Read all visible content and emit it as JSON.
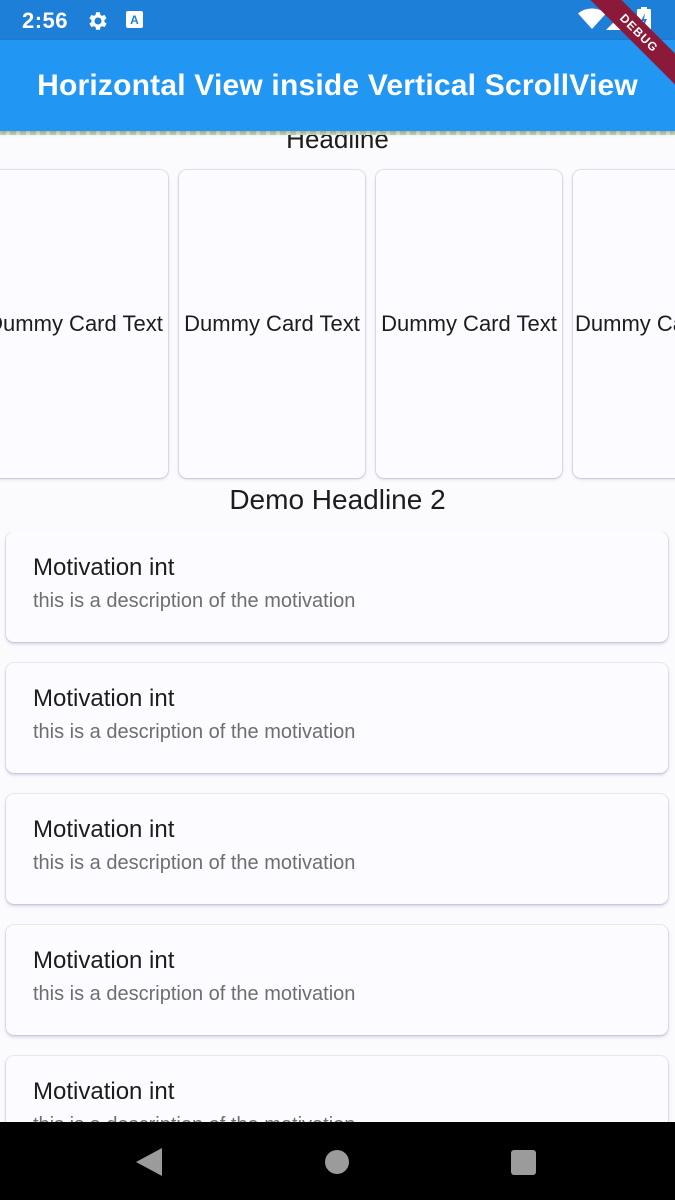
{
  "status_bar": {
    "time": "2:56",
    "icons": [
      "gear-icon",
      "a-notification-icon",
      "wifi-icon",
      "signal-icon",
      "battery-icon"
    ]
  },
  "app_bar": {
    "title": "Horizontal View inside Vertical ScrollView",
    "background": "#2196f3",
    "debug_label": "DEBUG"
  },
  "section1": {
    "headline": "Headline",
    "cards": [
      "Dummy Card Text",
      "Dummy Card Text",
      "Dummy Card Text",
      "Dummy Card Text"
    ]
  },
  "section2": {
    "headline": "Demo Headline 2",
    "items": [
      {
        "title": "Motivation int",
        "description": "this is a description of the motivation"
      },
      {
        "title": "Motivation int",
        "description": "this is a description of the motivation"
      },
      {
        "title": "Motivation int",
        "description": "this is a description of the motivation"
      },
      {
        "title": "Motivation int",
        "description": "this is a description of the motivation"
      },
      {
        "title": "Motivation int",
        "description": "this is a description of the motivation"
      }
    ]
  },
  "nav_bar": {
    "icons": [
      "back-icon",
      "home-icon",
      "recents-icon"
    ]
  }
}
